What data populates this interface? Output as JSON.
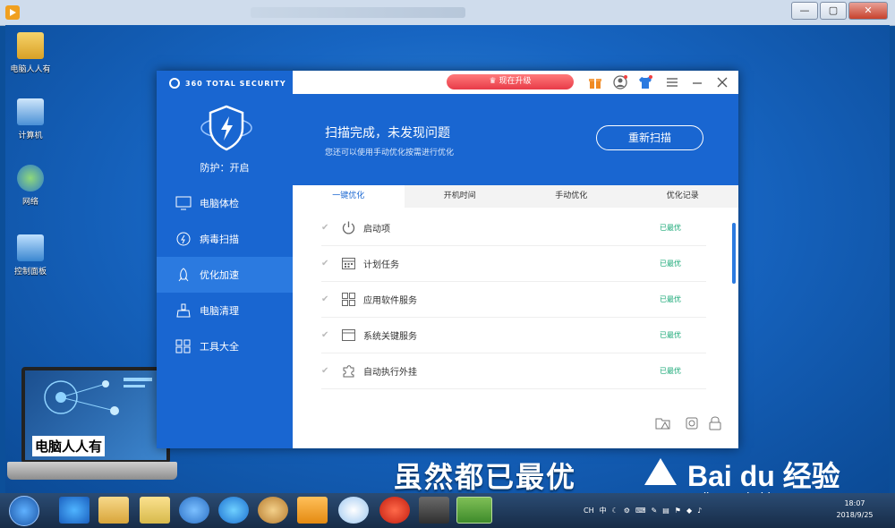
{
  "desktop_icons": [
    {
      "label": "电脑人人有",
      "icon": "folder-icon"
    },
    {
      "label": "计算机",
      "icon": "computer-icon"
    },
    {
      "label": "网络",
      "icon": "network-icon"
    },
    {
      "label": "控制面板",
      "icon": "control-panel-icon"
    }
  ],
  "laptop_caption": "电脑人人有",
  "app": {
    "brand": "360 TOTAL SECURITY",
    "protect_status": "防护：开启",
    "upgrade_label": "♛ 现在升级",
    "nav": [
      {
        "label": "电脑体检",
        "icon": "monitor-icon"
      },
      {
        "label": "病毒扫描",
        "icon": "scan-icon"
      },
      {
        "label": "优化加速",
        "icon": "rocket-icon"
      },
      {
        "label": "电脑清理",
        "icon": "broom-icon"
      },
      {
        "label": "工具大全",
        "icon": "grid-icon"
      }
    ],
    "header": {
      "title": "扫描完成，未发现问题",
      "subtitle": "您还可以使用手动优化按需进行优化",
      "rescan_label": "重新扫描"
    },
    "tabs": [
      "一键优化",
      "开机时间",
      "手动优化",
      "优化记录"
    ],
    "items": [
      {
        "label": "启动项",
        "status": "已最优",
        "icon": "power-icon"
      },
      {
        "label": "计划任务",
        "status": "已最优",
        "icon": "calendar-icon"
      },
      {
        "label": "应用软件服务",
        "status": "已最优",
        "icon": "apps-icon"
      },
      {
        "label": "系统关键服务",
        "status": "已最优",
        "icon": "window-icon"
      },
      {
        "label": "自动执行外挂",
        "status": "已最优",
        "icon": "puzzle-icon"
      }
    ]
  },
  "caption": "虽然都已最优",
  "watermark": {
    "logo": "Bai du 经验",
    "url": "jingyan.baidu.com"
  },
  "clock": {
    "time": "18:07",
    "date": "2018/9/25"
  },
  "tray_lang": "CH",
  "tray_ime": "中"
}
